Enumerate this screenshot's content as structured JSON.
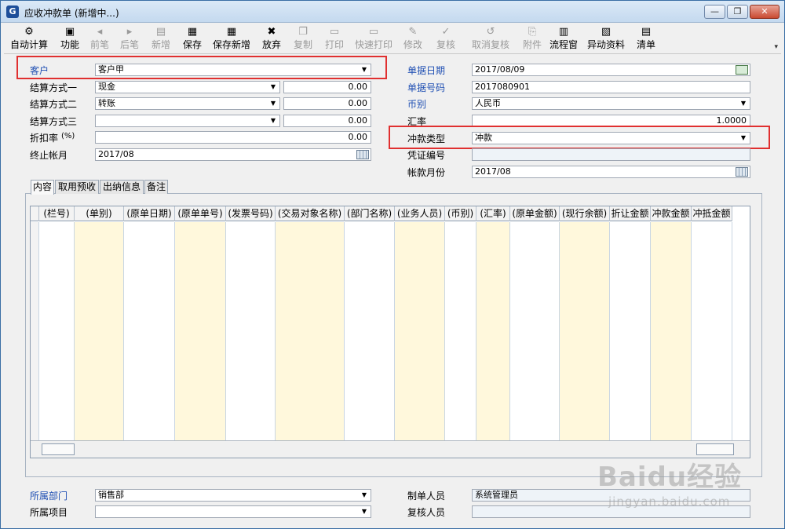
{
  "window": {
    "title": "应收冲款单 (新增中...)",
    "app_icon": "G",
    "controls": {
      "minimize": "—",
      "maximize": "❐",
      "close": "✕"
    }
  },
  "toolbar": {
    "items": [
      {
        "label": "自动计算",
        "icon": "calc-icon",
        "glyph": "⚙",
        "enabled": true
      },
      {
        "label": "功能",
        "icon": "cube-icon",
        "glyph": "▣",
        "enabled": true
      },
      {
        "label": "前笔",
        "icon": "arrow-left-icon",
        "glyph": "◂",
        "enabled": false
      },
      {
        "label": "后笔",
        "icon": "arrow-right-icon",
        "glyph": "▸",
        "enabled": false
      },
      {
        "label": "新增",
        "icon": "new-doc-icon",
        "glyph": "▤",
        "enabled": false
      },
      {
        "label": "保存",
        "icon": "save-icon",
        "glyph": "▦",
        "enabled": true
      },
      {
        "label": "保存新增",
        "icon": "save-new-icon",
        "glyph": "▦",
        "enabled": true
      },
      {
        "label": "放弃",
        "icon": "cancel-icon",
        "glyph": "✖",
        "enabled": true
      },
      {
        "label": "复制",
        "icon": "copy-icon",
        "glyph": "❐",
        "enabled": false
      },
      {
        "label": "打印",
        "icon": "print-icon",
        "glyph": "▭",
        "enabled": false
      },
      {
        "label": "快速打印",
        "icon": "quick-print-icon",
        "glyph": "▭",
        "enabled": false
      },
      {
        "label": "修改",
        "icon": "edit-icon",
        "glyph": "✎",
        "enabled": false
      },
      {
        "label": "复核",
        "icon": "review-icon",
        "glyph": "✓",
        "enabled": false
      },
      {
        "label": "取消复核",
        "icon": "cancel-review-icon",
        "glyph": "↺",
        "enabled": false
      },
      {
        "label": "附件",
        "icon": "attachment-icon",
        "glyph": "⎘",
        "enabled": false
      },
      {
        "label": "流程窗",
        "icon": "flow-window-icon",
        "glyph": "▥",
        "enabled": true
      },
      {
        "label": "异动资料",
        "icon": "change-data-icon",
        "glyph": "▧",
        "enabled": true
      },
      {
        "label": "清单",
        "icon": "list-icon",
        "glyph": "▤",
        "enabled": true
      }
    ],
    "more": "▾"
  },
  "form": {
    "customer": {
      "label": "客户",
      "value": "客户甲"
    },
    "settle1": {
      "label": "结算方式一",
      "value": "现金",
      "amount": "0.00"
    },
    "settle2": {
      "label": "结算方式二",
      "value": "转账",
      "amount": "0.00"
    },
    "settle3": {
      "label": "结算方式三",
      "value": "",
      "amount": "0.00"
    },
    "discount": {
      "label": "折扣率",
      "unit": "(%)",
      "value": "0.00"
    },
    "end_month": {
      "label": "终止帐月",
      "value": "2017/08"
    },
    "doc_date": {
      "label": "单据日期",
      "value": "2017/08/09"
    },
    "doc_no": {
      "label": "单据号码",
      "value": "2017080901"
    },
    "currency": {
      "label": "币别",
      "value": "人民币"
    },
    "rate": {
      "label": "汇率",
      "value": "1.0000"
    },
    "offset_type": {
      "label": "冲款类型",
      "value": "冲款"
    },
    "voucher_no": {
      "label": "凭证编号",
      "value": ""
    },
    "account_month": {
      "label": "帐款月份",
      "value": "2017/08"
    }
  },
  "tabs": [
    "内容",
    "取用预收",
    "出纳信息",
    "备注"
  ],
  "grid": {
    "columns": [
      "(栏号)",
      "(单别)",
      "(原单日期)",
      "(原单单号)",
      "(发票号码)",
      "(交易对象名称)",
      "(部门名称)",
      "(业务人员)",
      "(币别)",
      "(汇率)",
      "(原单金额)",
      "(现行余额)",
      "折让金额",
      "冲款金额",
      "冲抵金额"
    ],
    "row_count": 16
  },
  "footer": {
    "dept": {
      "label": "所属部门",
      "value": "销售部"
    },
    "project": {
      "label": "所属项目",
      "value": ""
    },
    "creator": {
      "label": "制单人员",
      "value": "系统管理员"
    },
    "reviewer": {
      "label": "复核人员",
      "value": ""
    }
  },
  "watermark": {
    "main": "Baidu经验",
    "sub": "jingyan.baidu.com"
  },
  "colors": {
    "label_blue": "#1f4fb3",
    "highlight_red": "#e03030",
    "row_yellow": "#fff8dc"
  }
}
